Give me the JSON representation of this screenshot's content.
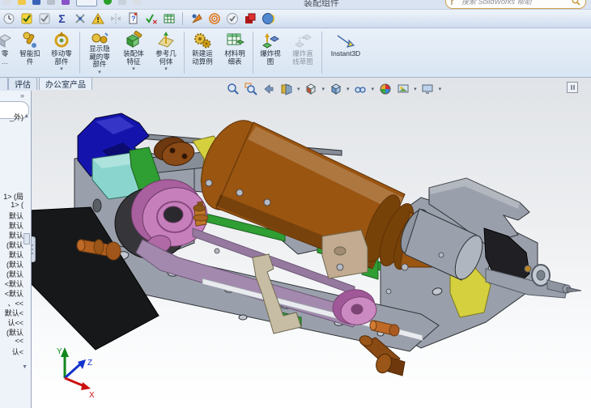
{
  "window": {
    "title": "装配组件",
    "search_placeholder": "搜索 SolidWorks 帮助"
  },
  "ui": {
    "caret": "▾",
    "chevron_right": "»",
    "scroll_up": "▲",
    "scroll_down": "▼"
  },
  "tools_toolbar": {
    "icons": [
      "clock-icon",
      "checked-box-yellow-icon",
      "checked-box-gray-icon",
      "sigma-icon",
      "trim-icon",
      "warning-triangle-icon",
      "symmetry-icon",
      "help-document-icon",
      "verify-check-icon",
      "excel-table-icon",
      "render-tools-icon",
      "rings-icon",
      "check-circle-icon",
      "red-squares-icon",
      "sphere-icon"
    ],
    "sigma_glyph": "Σ",
    "warning_glyph": "!"
  },
  "command_manager": {
    "buttons": [
      {
        "id": "insert-component",
        "line1": "零",
        "line2": "…",
        "dropdown": false
      },
      {
        "id": "smart-fasteners",
        "line1": "智能扣",
        "line2": "件",
        "dropdown": false
      },
      {
        "id": "move-component",
        "line1": "移动零",
        "line2": "部件",
        "dropdown": true
      },
      {
        "id": "show-hidden-components",
        "line1": "显示隐",
        "line2": "藏的零",
        "line3": "部件",
        "dropdown": true
      },
      {
        "id": "assembly-features",
        "line1": "装配体",
        "line2": "特征",
        "dropdown": true
      },
      {
        "id": "reference-geometry",
        "line1": "参考几",
        "line2": "何体",
        "dropdown": true
      },
      {
        "id": "new-motion-study",
        "line1": "新建运",
        "line2": "动算例",
        "dropdown": false
      },
      {
        "id": "bill-of-materials",
        "line1": "材料明",
        "line2": "细表",
        "dropdown": false
      },
      {
        "id": "exploded-view",
        "line1": "爆炸视",
        "line2": "图",
        "dropdown": false
      },
      {
        "id": "explode-line-sketch",
        "line1": "爆炸直",
        "line2": "线草图",
        "dropdown": false,
        "disabled": true
      },
      {
        "id": "instant3d",
        "line1": "Instant3D",
        "dropdown": false
      }
    ]
  },
  "tabs": {
    "items": [
      {
        "label": "评估"
      },
      {
        "label": "办公室产品"
      }
    ]
  },
  "feature_tree": {
    "lines": [
      "_外)",
      "1> (局",
      "1> (",
      "默认",
      "默认",
      "默认",
      "(默认",
      "默认",
      "(默认",
      "(默认",
      "<默认",
      "<默认",
      "、<<",
      "默认<",
      "认<<",
      "(默认",
      "<<",
      "认<"
    ]
  },
  "headsup_toolbar": {
    "icons": [
      "zoom-to-fit-icon",
      "zoom-to-area-icon",
      "previous-view-icon",
      "section-view-icon",
      "view-orientation-icon",
      "display-style-icon",
      "hide-show-items-icon",
      "edit-appearance-icon",
      "apply-scene-icon",
      "view-settings-icon"
    ]
  },
  "triad": {
    "x_label": "X",
    "y_label": "Y",
    "z_label": "Z",
    "x_color": "#cc1111",
    "y_color": "#11881d",
    "z_color": "#1133cc"
  },
  "model": {
    "parts": [
      "base-frame",
      "motor",
      "motor-housing",
      "blue-bracket",
      "cyan-slide-block",
      "green-linear-rail",
      "yellow-clamps",
      "pink-pulley",
      "idler-pulley",
      "drive-belt",
      "black-mount-plate",
      "tan-guide-bracket",
      "beige-block",
      "orange-pins",
      "brown-bolt",
      "brass-fitting",
      "right-probe-assembly",
      "brown-hub",
      "dark-wheel"
    ],
    "colors": {
      "frame": "#9aa0ab",
      "frame_dark": "#878d97",
      "silver": "#e9ebef",
      "motor": "#9a5511",
      "motor_dark": "#774208",
      "housing": "#9aa1ac",
      "blue": "#1414ad",
      "cyan": "#8ad6ce",
      "green": "#2f9e33",
      "yellow": "#d4d03e",
      "magenta": "#c77fbc",
      "magenta_dark": "#a9609f",
      "belt": "#a489ae",
      "belt_dark": "#96799f",
      "black": "#17181a",
      "dark_wheel": "#36363a",
      "tan": "#c6bda4",
      "beige": "#c2ab90",
      "orange": "#c06a28",
      "brown": "#8a4a14",
      "brass": "#c07828"
    }
  }
}
